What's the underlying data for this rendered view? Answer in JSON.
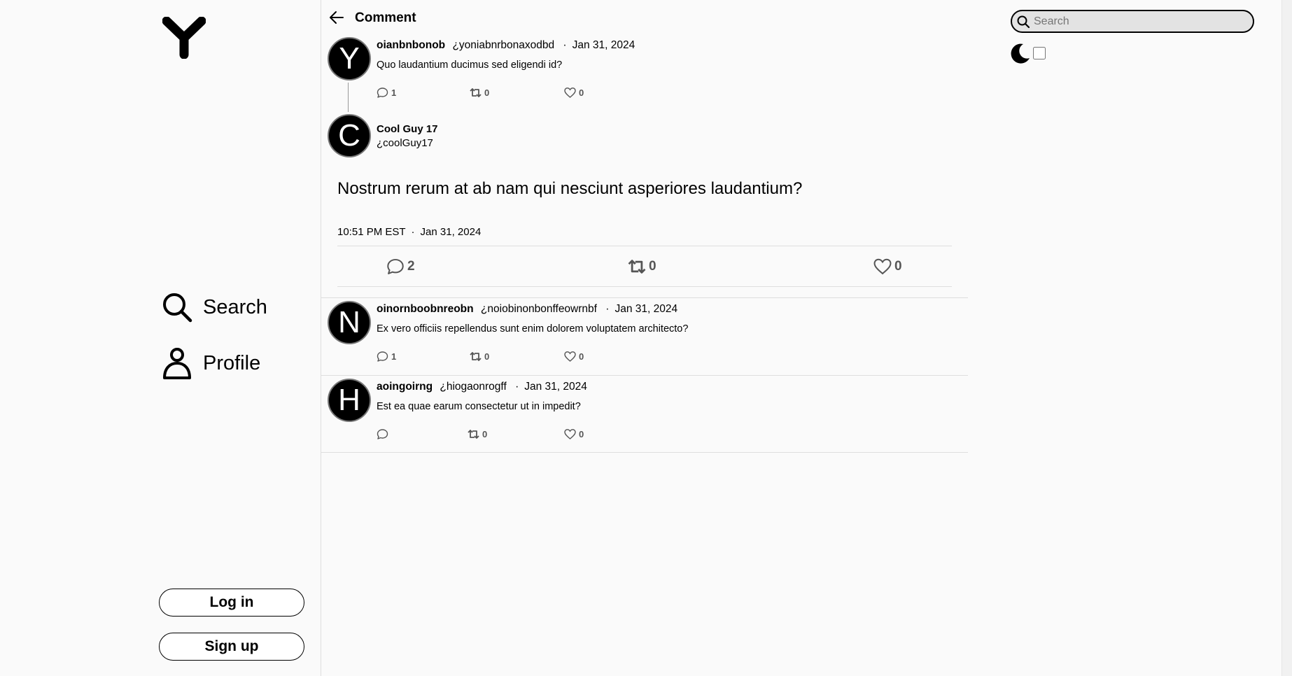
{
  "sidebar": {
    "logo": "Y",
    "nav": [
      {
        "label": "Search",
        "icon": "search-icon"
      },
      {
        "label": "Profile",
        "icon": "person-icon"
      }
    ],
    "login_label": "Log in",
    "signup_label": "Sign up"
  },
  "header": {
    "title": "Comment",
    "back_icon": "arrow-left-icon"
  },
  "parent_post": {
    "avatar_letter": "Y",
    "name": "oianbnbonob",
    "handle": "¿yoniabnrbonaxodbd",
    "date": "Jan 31, 2024",
    "text": "Quo laudantium ducimus sed eligendi id?",
    "replies": "1",
    "reposts": "0",
    "likes": "0"
  },
  "main_post": {
    "avatar_letter": "C",
    "name": "Cool Guy 17",
    "handle": "¿coolGuy17",
    "text": "Nostrum rerum at ab nam qui nesciunt asperiores laudantium?",
    "time": "10:51 PM EST",
    "date": "Jan 31, 2024",
    "replies": "2",
    "reposts": "0",
    "likes": "0"
  },
  "replies": [
    {
      "avatar_letter": "N",
      "name": "oinornboobnreobn",
      "handle": "¿noiobinonbonffeowrnbf",
      "date": "Jan 31, 2024",
      "text": "Ex vero officiis repellendus sunt enim dolorem voluptatem architecto?",
      "replies": "1",
      "reposts": "0",
      "likes": "0"
    },
    {
      "avatar_letter": "H",
      "name": "aoingoirng",
      "handle": "¿hiogaonrogff",
      "date": "Jan 31, 2024",
      "text": "Est ea quae earum consectetur ut in impedit?",
      "replies": "",
      "reposts": "0",
      "likes": "0"
    }
  ],
  "right": {
    "search_placeholder": "Search",
    "theme_icon": "moon-icon"
  },
  "separator": "·"
}
